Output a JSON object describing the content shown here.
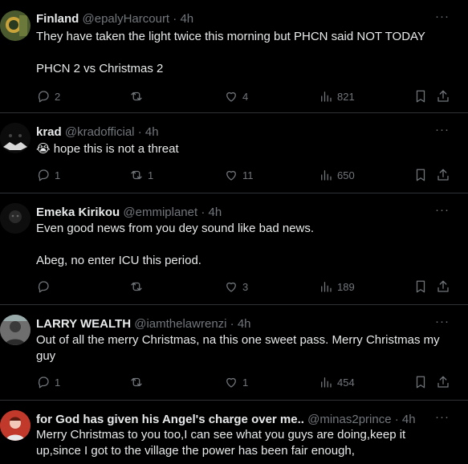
{
  "tweets": [
    {
      "name": "Finland",
      "handle": "@epalyHarcourt",
      "time": "4h",
      "text": "They have taken the light twice this morning but PHCN said NOT TODAY\n\nPHCN 2 vs Christmas 2",
      "replies": "2",
      "retweets": "",
      "likes": "4",
      "views": "821"
    },
    {
      "name": "krad",
      "handle": "@kradofficial",
      "time": "4h",
      "text": "😭 hope this is not a threat",
      "replies": "1",
      "retweets": "1",
      "likes": "11",
      "views": "650"
    },
    {
      "name": "Emeka Kirikou",
      "handle": "@emmiplanet",
      "time": "4h",
      "text": "Even good news from you dey sound like bad news.\n\nAbeg, no enter ICU this period.",
      "replies": "",
      "retweets": "",
      "likes": "3",
      "views": "189"
    },
    {
      "name": "LARRY WEALTH",
      "handle": "@iamthelawrenzi",
      "time": "4h",
      "text": "Out of all the merry Christmas, na this one sweet pass. Merry Christmas my guy",
      "replies": "1",
      "retweets": "",
      "likes": "1",
      "views": "454"
    },
    {
      "name": "for God has given his Angel's charge over me..",
      "handle": "@minas2prince",
      "time": "4h",
      "text": "Merry Christmas to you too,I can see what you guys are doing,keep it up,since I got to the village the power has been fair enough,",
      "replies": "",
      "retweets": "",
      "likes": "",
      "views": ""
    }
  ],
  "ui": {
    "separator": "·",
    "more": "···"
  },
  "colors": {
    "background": "#000000",
    "text": "#e7e9ea",
    "muted": "#71767b",
    "border": "#2f3336"
  }
}
